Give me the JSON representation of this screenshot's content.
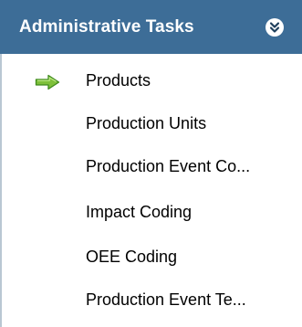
{
  "panel": {
    "title": "Administrative Tasks",
    "collapse_icon": "double-chevron-down-icon",
    "colors": {
      "header_bg": "#3d6d97",
      "header_text": "#ffffff",
      "arrow_fill": "#7ec03a",
      "arrow_stroke": "#3f8a1c",
      "border": "#b9c7d3"
    },
    "current_item_icon": "right-arrow-icon",
    "items": [
      {
        "label": "Products",
        "current": true
      },
      {
        "label": "Production Units",
        "current": false
      },
      {
        "label": "Production Event Co...",
        "current": false
      },
      {
        "label": "Impact Coding",
        "current": false
      },
      {
        "label": "OEE Coding",
        "current": false
      },
      {
        "label": "Production Event Te...",
        "current": false
      }
    ]
  }
}
